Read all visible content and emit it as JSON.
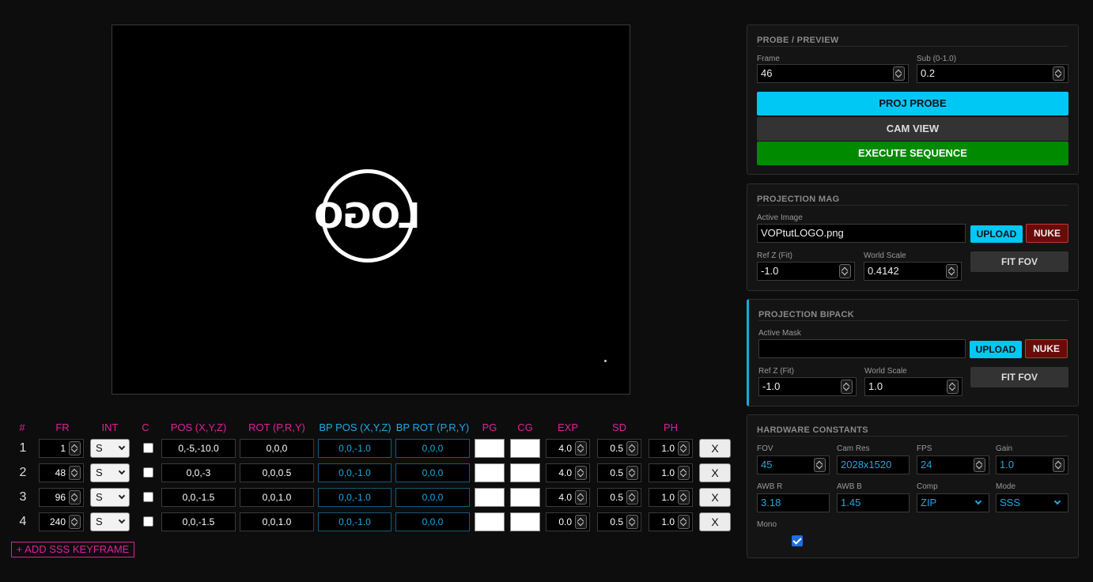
{
  "preview": {
    "logo_text": "LOGO"
  },
  "table": {
    "headers": {
      "num": "#",
      "fr": "FR",
      "int": "INT",
      "c": "C",
      "pos": "POS (X,Y,Z)",
      "rot": "ROT (P,R,Y)",
      "bp_pos": "BP POS (X,Y,Z)",
      "bp_rot": "BP ROT (P,R,Y)",
      "pg": "PG",
      "cg": "CG",
      "exp": "EXP",
      "sd": "SD",
      "ph": "PH"
    },
    "rows": [
      {
        "num": "1",
        "fr": "1",
        "int": "S",
        "pos": "0,-5,-10.0",
        "rot": "0,0,0",
        "bp_pos": "0,0,-1.0",
        "bp_rot": "0,0,0",
        "exp": "4.0",
        "sd": "0.5",
        "ph": "1.0",
        "remove": "X"
      },
      {
        "num": "2",
        "fr": "48",
        "int": "S",
        "pos": "0,0,-3",
        "rot": "0,0,0.5",
        "bp_pos": "0,0,-1.0",
        "bp_rot": "0,0,0",
        "exp": "4.0",
        "sd": "0.5",
        "ph": "1.0",
        "remove": "X"
      },
      {
        "num": "3",
        "fr": "96",
        "int": "S",
        "pos": "0,0,-1.5",
        "rot": "0,0,1.0",
        "bp_pos": "0,0,-1.0",
        "bp_rot": "0,0,0",
        "exp": "4.0",
        "sd": "0.5",
        "ph": "1.0",
        "remove": "X"
      },
      {
        "num": "4",
        "fr": "240",
        "int": "S",
        "pos": "0,0,-1.5",
        "rot": "0,0,1.0",
        "bp_pos": "0,0,-1.0",
        "bp_rot": "0,0,0",
        "exp": "0.0",
        "sd": "0.5",
        "ph": "1.0",
        "remove": "X"
      }
    ],
    "add_label": "+ ADD SSS KEYFRAME"
  },
  "probe": {
    "title": "PROBE / PREVIEW",
    "frame_label": "Frame",
    "frame_value": "46",
    "sub_label": "Sub (0-1.0)",
    "sub_value": "0.2",
    "proj_probe": "PROJ PROBE",
    "cam_view": "CAM VIEW",
    "execute": "EXECUTE SEQUENCE"
  },
  "mag": {
    "title": "PROJECTION MAG",
    "image_label": "Active Image",
    "image_value": "VOPtutLOGO.png",
    "upload": "UPLOAD",
    "nuke": "NUKE",
    "refz_label": "Ref Z (Fit)",
    "refz_value": "-1.0",
    "scale_label": "World Scale",
    "scale_value": "0.4142",
    "fit": "FIT FOV"
  },
  "bipack": {
    "title": "PROJECTION BIPACK",
    "mask_label": "Active Mask",
    "mask_value": "",
    "upload": "UPLOAD",
    "nuke": "NUKE",
    "refz_label": "Ref Z (Fit)",
    "refz_value": "-1.0",
    "scale_label": "World Scale",
    "scale_value": "1.0",
    "fit": "FIT FOV"
  },
  "hw": {
    "title": "HARDWARE CONSTANTS",
    "fov_label": "FOV",
    "fov_value": "45",
    "camres_label": "Cam Res",
    "camres_value": "2028x1520",
    "fps_label": "FPS",
    "fps_value": "24",
    "gain_label": "Gain",
    "gain_value": "1.0",
    "awbr_label": "AWB R",
    "awbr_value": "3.18",
    "awbb_label": "AWB B",
    "awbb_value": "1.45",
    "comp_label": "Comp",
    "comp_value": "ZIP",
    "mode_label": "Mode",
    "mode_value": "SSS",
    "mono_label": "Mono",
    "mono_checked": true
  },
  "colors": {
    "magenta": "#e0209c",
    "cyan": "#1fa8e0",
    "probe_btn": "#00c8f5",
    "execute_btn": "#008a00",
    "nuke": "#6a0b0b"
  }
}
